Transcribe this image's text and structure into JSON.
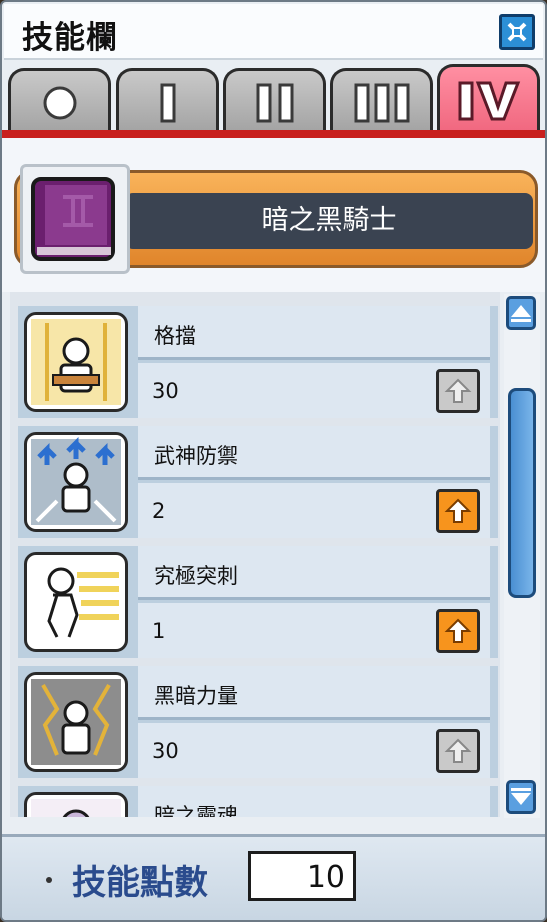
{
  "window": {
    "title": "技能欄"
  },
  "tabs": [
    {
      "label": "0",
      "icon": "circle-icon"
    },
    {
      "label": "I",
      "icon": "roman-1-icon"
    },
    {
      "label": "II",
      "icon": "roman-2-icon"
    },
    {
      "label": "III",
      "icon": "roman-3-icon"
    },
    {
      "label": "IV",
      "icon": "roman-4-icon",
      "active": true
    }
  ],
  "job": {
    "name": "暗之黑騎士",
    "icon": "skill-book-icon"
  },
  "skills": [
    {
      "name": "格擋",
      "level": "30",
      "upgrade_available": false,
      "icon": "block-skill-icon"
    },
    {
      "name": "武神防禦",
      "level": "2",
      "upgrade_available": true,
      "icon": "guard-skill-icon"
    },
    {
      "name": "究極突刺",
      "level": "1",
      "upgrade_available": true,
      "icon": "thrust-skill-icon"
    },
    {
      "name": "黑暗力量",
      "level": "30",
      "upgrade_available": false,
      "icon": "dark-power-skill-icon"
    },
    {
      "name": "暗之靈魂",
      "level": "",
      "upgrade_available": false,
      "icon": "dark-soul-skill-icon"
    }
  ],
  "footer": {
    "label": "技能點數",
    "value": "10"
  },
  "colors": {
    "active_tab": "#f0667e",
    "upgrade": "#f7941d",
    "accent_line": "#c8201e",
    "scrollbar": "#5a9fe0"
  }
}
